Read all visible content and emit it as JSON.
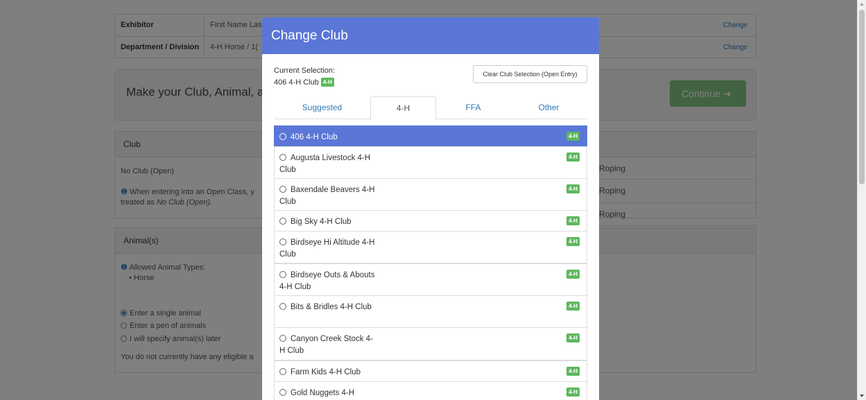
{
  "background": {
    "info": {
      "exhibitor_label": "Exhibitor",
      "exhibitor_value": "First Name Las",
      "department_label": "Department / Division",
      "department_value": "4-H Horse  /  1(",
      "change_label": "Change"
    },
    "prompt": {
      "text": "Make your Club, Animal, a",
      "continue_label": "Continue"
    },
    "club_panel": {
      "heading": "Club",
      "no_club": "No Club (Open)",
      "note_icon": "info-icon",
      "note_text_1": "When entering into an Open Class, y",
      "note_text_2": "treated as",
      "note_text_em": "No Club (Open)."
    },
    "roping_label": "Roping",
    "animal_panel": {
      "heading": "Animal(s)",
      "allowed_label": "Allowed Animal Types:",
      "allowed_item": "Horse",
      "options": [
        "Enter a single animal",
        "Enter a pen of animals",
        "I will specify animal(s) later"
      ],
      "no_eligible": "You do not currently have any eligible a"
    }
  },
  "modal": {
    "title": "Change Club",
    "current_label": "Current Selection:",
    "current_value": "406 4-H Club",
    "badge": "4-H",
    "clear_button": "Clear Club Selection (Open Entry)",
    "tabs": [
      "Suggested",
      "4-H",
      "FFA",
      "Other"
    ],
    "active_tab": "4-H",
    "clubs": [
      {
        "name": "406 4-H Club",
        "badge": "4-H",
        "selected": true
      },
      {
        "name": "Augusta Livestock 4-H Club",
        "badge": "4-H",
        "selected": false
      },
      {
        "name": "Baxendale Beavers 4-H Club",
        "badge": "4-H",
        "selected": false
      },
      {
        "name": "Big Sky 4-H Club",
        "badge": "4-H",
        "selected": false
      },
      {
        "name": "Birdseye Hi Altitude 4-H Club",
        "badge": "4-H",
        "selected": false
      },
      {
        "name": "Birdseye Outs & Abouts 4-H Club",
        "badge": "4-H",
        "selected": false
      },
      {
        "name": "Bits & Bridles 4-H Club",
        "badge": "4-H",
        "selected": false
      },
      {
        "name": "Canyon Creek Stock 4-H Club",
        "badge": "4-H",
        "selected": false
      },
      {
        "name": "Farm Kids 4-H Club",
        "badge": "4-H",
        "selected": false
      },
      {
        "name": "Gold Nuggets 4-H",
        "badge": "4-H",
        "selected": false
      }
    ]
  },
  "colors": {
    "modal_header": "#5a76d6",
    "badge_green": "#5cb85c",
    "link_blue": "#337ab7"
  }
}
